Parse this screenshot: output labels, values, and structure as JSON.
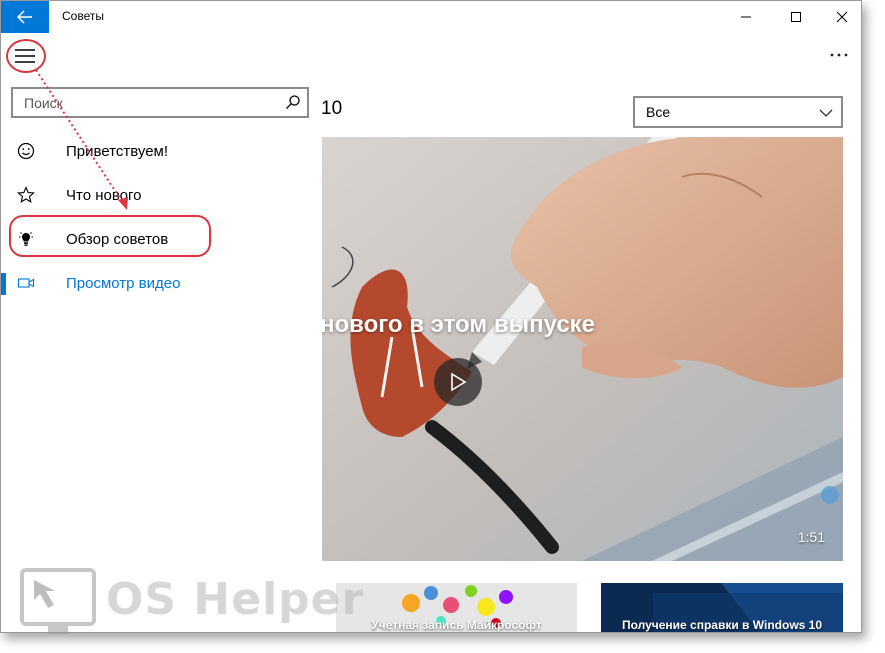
{
  "app": {
    "title": "Советы"
  },
  "search": {
    "placeholder": "Поиск"
  },
  "sidebar": {
    "items": [
      {
        "label": "Приветствуем!",
        "icon": "smile-icon"
      },
      {
        "label": "Что нового",
        "icon": "star-icon"
      },
      {
        "label": "Обзор советов",
        "icon": "lightbulb-icon"
      },
      {
        "label": "Просмотр видео",
        "icon": "video-icon",
        "active": true
      }
    ]
  },
  "main": {
    "count": "10",
    "filter": {
      "selected": "Все"
    },
    "video": {
      "caption": "нового в этом выпуске",
      "duration": "1:51"
    },
    "thumbs": [
      {
        "title": "Учетная запись Майкрософт"
      },
      {
        "title": "Получение справки в Windows 10"
      }
    ]
  },
  "watermark": {
    "text": "OS Helper"
  },
  "colors": {
    "accent": "#0078d7",
    "highlight_ring": "#d9363e"
  }
}
